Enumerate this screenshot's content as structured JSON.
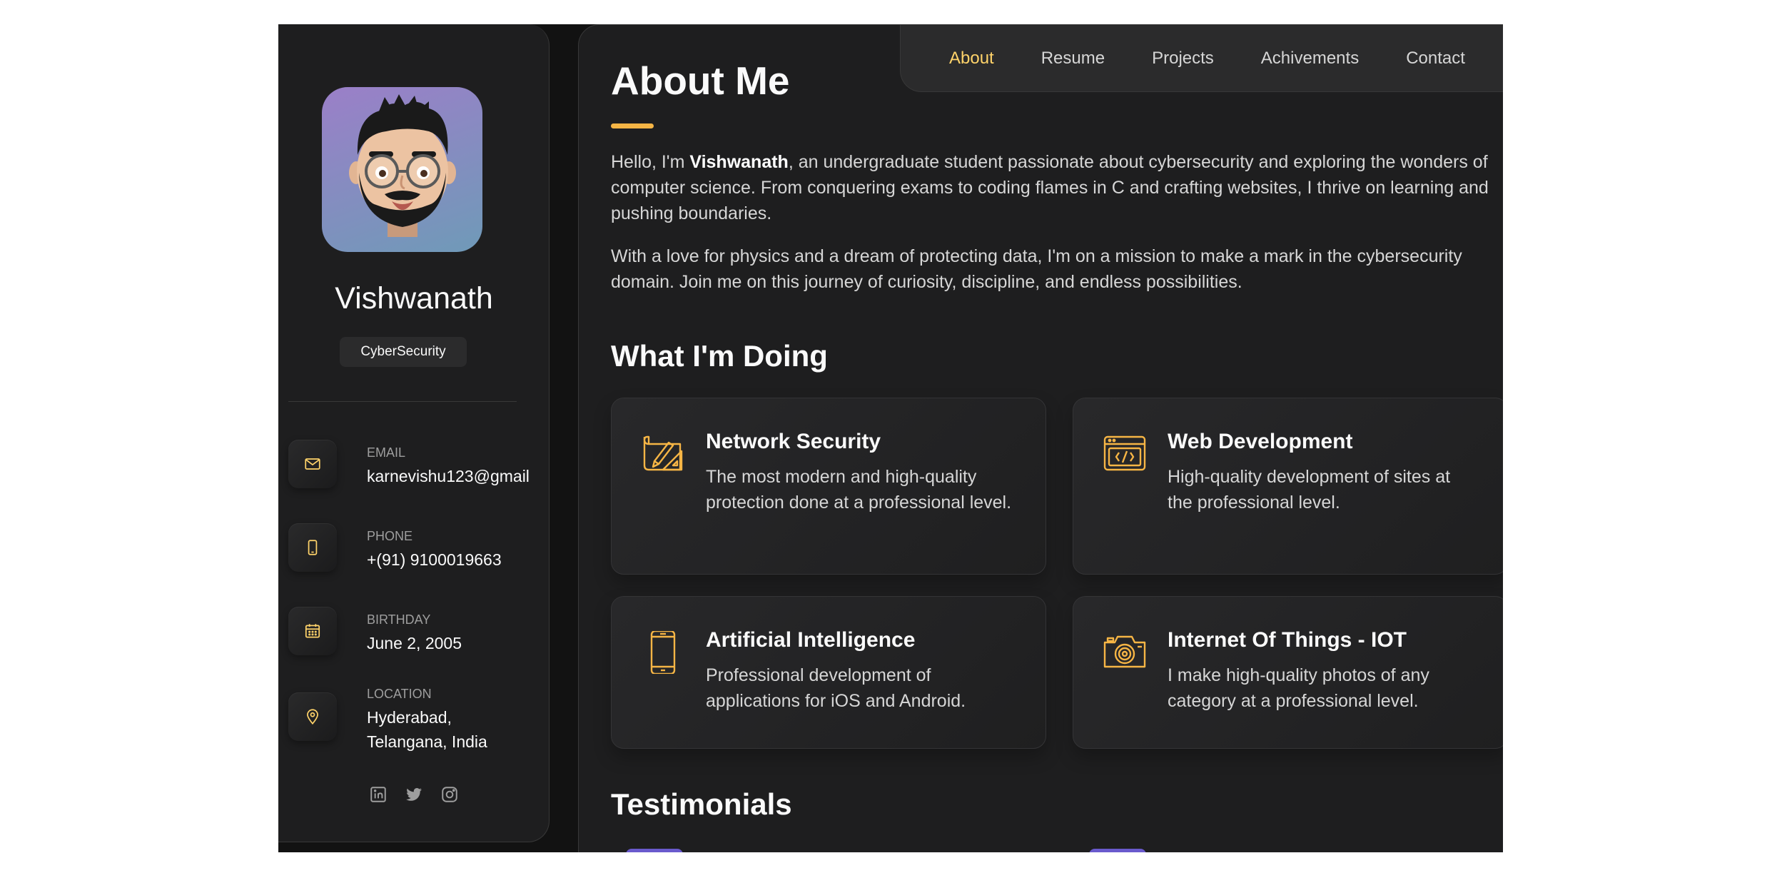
{
  "profile": {
    "name": "Vishwanath",
    "role": "CyberSecurity"
  },
  "contacts": [
    {
      "title": "Email",
      "value": "karnevishu123@gmail",
      "icon": "mail-icon"
    },
    {
      "title": "Phone",
      "value": "+(91) 9100019663",
      "icon": "phone-icon"
    },
    {
      "title": "Birthday",
      "value": "June 2, 2005",
      "icon": "calendar-icon"
    },
    {
      "title": "Location",
      "value": "Hyderabad, Telangana, India",
      "icon": "location-pin-icon"
    }
  ],
  "socials": [
    "linkedin-icon",
    "twitter-icon",
    "instagram-icon"
  ],
  "nav": {
    "items": [
      "About",
      "Resume",
      "Projects",
      "Achivements",
      "Contact"
    ],
    "active": "About"
  },
  "about": {
    "title": "About Me",
    "p1_prefix": "Hello, I'm ",
    "p1_name": "Vishwanath",
    "p1_suffix": ", an undergraduate student passionate about cybersecurity and exploring the wonders of computer science. From conquering exams to coding flames in C and crafting websites, I thrive on learning and pushing boundaries.",
    "p2": "With a love for physics and a dream of protecting data, I'm on a mission to make a mark in the cybersecurity domain. Join me on this journey of curiosity, discipline, and endless possibilities."
  },
  "services": {
    "title": "What I'm Doing",
    "items": [
      {
        "title": "Network Security",
        "text": "The most modern and high-quality protection done at a professional level.",
        "icon": "design-tools-icon"
      },
      {
        "title": "Web Development",
        "text": "High-quality development of sites at the professional level.",
        "icon": "code-window-icon"
      },
      {
        "title": "Artificial Intelligence",
        "text": "Professional development of applications for iOS and Android.",
        "icon": "smartphone-icon"
      },
      {
        "title": "Internet Of Things - IOT",
        "text": "I make high-quality photos of any category at a professional level.",
        "icon": "camera-icon"
      }
    ]
  },
  "testimonials": {
    "title": "Testimonials"
  },
  "colors": {
    "accent": "#ffd36a",
    "accent_bar": "#f6b545",
    "background": "#121212",
    "card": "#1e1e1f"
  }
}
